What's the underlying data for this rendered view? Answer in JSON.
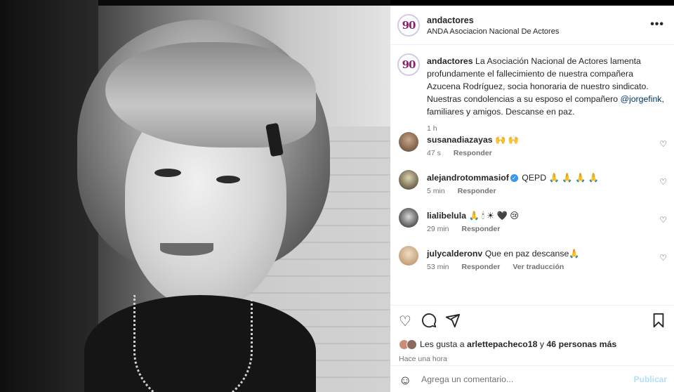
{
  "post": {
    "author": "andactores",
    "author_subtitle": "ANDA Asociacion Nacional De Actores",
    "logo_text": "90",
    "more_label": "•••",
    "caption_text_before": " La Asociación Nacional de Actores lamenta profundamente el fallecimiento de nuestra compañera Azucena Rodríguez, socia honoraria de nuestro sindicato. Nuestras condolencias a su esposo el compañero ",
    "caption_mention": "@jorgefink",
    "caption_text_after": ", familiares y amigos. Descanse en paz.",
    "caption_time": "1 h"
  },
  "comments": [
    {
      "user": "susanadiazayas",
      "text": " 🙌 🙌",
      "time": "47 s",
      "reply": "Responder",
      "translate": ""
    },
    {
      "user": "alejandrotommasiof",
      "verified": true,
      "text": " QEPD 🙏 🙏 🙏 🙏",
      "time": "5 min",
      "reply": "Responder",
      "translate": ""
    },
    {
      "user": "lialibelula",
      "text": " 🙏 🕯 ☀ 🖤 😢",
      "time": "29 min",
      "reply": "Responder",
      "translate": ""
    },
    {
      "user": "julycalderonv",
      "text": " Que en paz descanse🙏",
      "time": "53 min",
      "reply": "Responder",
      "translate": "Ver traducción"
    }
  ],
  "likes": {
    "prefix": "Les gusta a ",
    "user": "arlettepacheco18",
    "middle": " y ",
    "count": "46 personas más",
    "time": "Hace una hora"
  },
  "add_comment": {
    "placeholder": "Agrega un comentario...",
    "post_label": "Publicar"
  },
  "colors": {
    "accent": "#0095f6",
    "mention": "#00376b",
    "muted": "#737373"
  }
}
